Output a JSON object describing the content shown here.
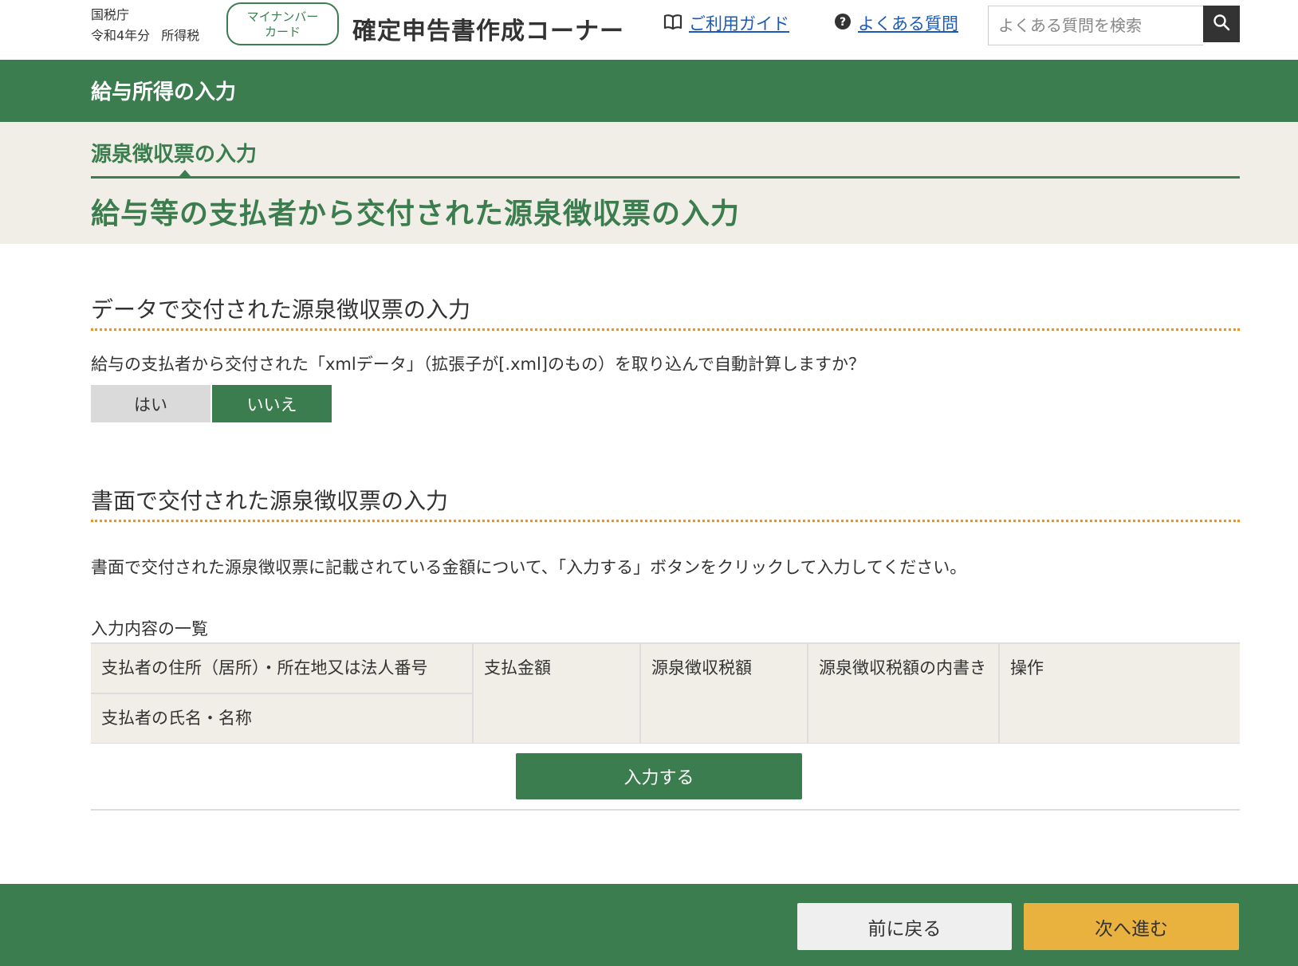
{
  "header": {
    "agency": "国税庁",
    "year": "令和4年分",
    "tax_type": "所得税",
    "mynumber_line1": "マイナンバー",
    "mynumber_line2": "カード",
    "corner_title": "確定申告書作成コーナー",
    "guide_label": "ご利用ガイド",
    "faq_label": "よくある質問",
    "search_placeholder": "よくある質問を検索",
    "icons": {
      "guide": "book-icon",
      "faq": "question-circle-icon",
      "search": "search-icon"
    }
  },
  "section_bar": {
    "title": "給与所得の入力"
  },
  "subheader": {
    "step_title": "源泉徴収票の入力",
    "page_title": "給与等の支払者から交付された源泉徴収票の入力"
  },
  "data_section": {
    "heading": "データで交付された源泉徴収票の入力",
    "question": "給与の支払者から交付された「xmlデータ」（拡張子が[.xml]のもの）を取り込んで自動計算しますか？",
    "yes_label": "はい",
    "no_label": "いいえ",
    "selected": "いいえ"
  },
  "paper_section": {
    "heading": "書面で交付された源泉徴収票の入力",
    "instruction": "書面で交付された源泉徴収票に記載されている金額について、「入力する」ボタンをクリックして入力してください。",
    "list_caption": "入力内容の一覧",
    "columns": {
      "address": "支払者の住所（居所）・所在地又は法人番号",
      "name": "支払者の氏名・名称",
      "amount": "支払金額",
      "withholding": "源泉徴収税額",
      "withholding_inner": "源泉徴収税額の内書き",
      "operation": "操作"
    },
    "enter_button": "入力する"
  },
  "footer": {
    "back_label": "前に戻る",
    "next_label": "次へ進む"
  },
  "colors": {
    "primary_green": "#3b7d4f",
    "beige": "#f0eee6",
    "accent_orange": "#e8932c",
    "next_button": "#e9b23f",
    "link_blue": "#1a5ab8"
  }
}
